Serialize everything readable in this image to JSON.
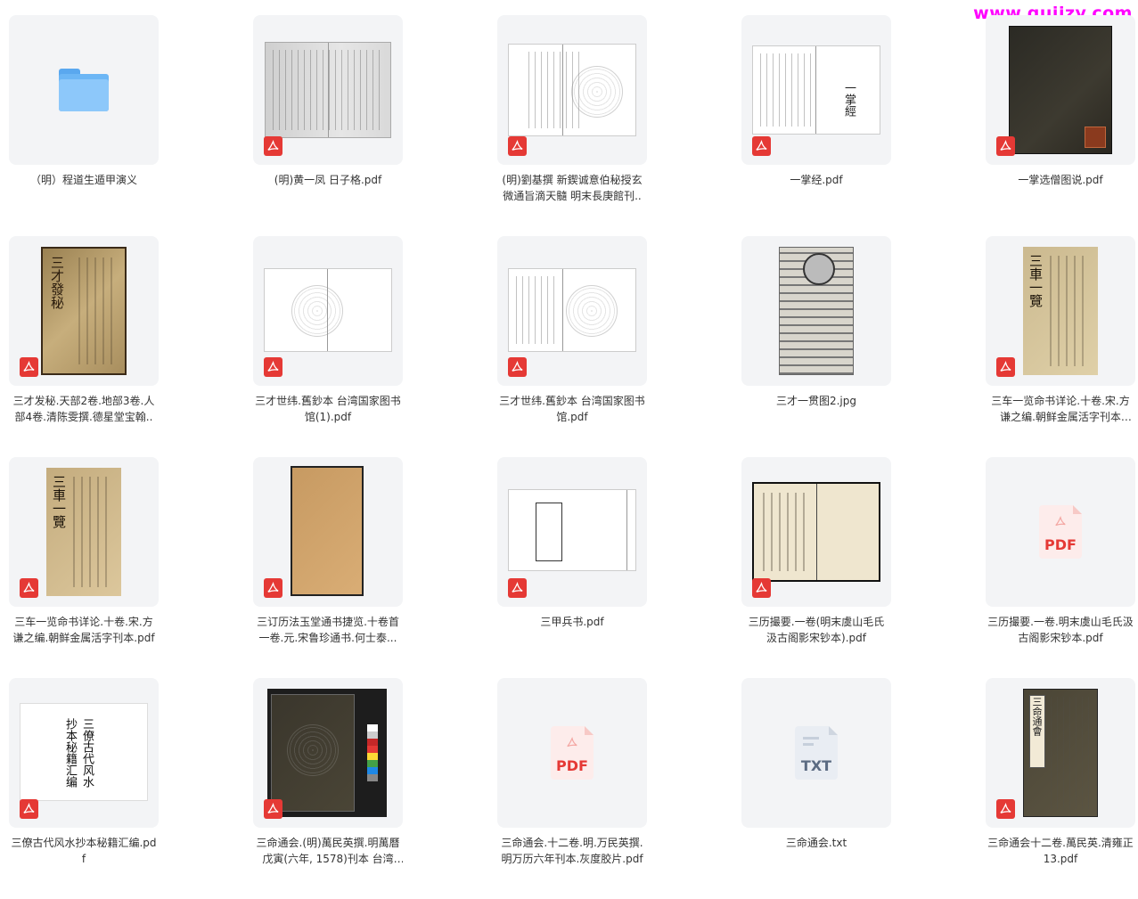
{
  "watermark": "www.gujizy.com",
  "colors": {
    "pdf_badge": "#e53935",
    "folder": "#6cb6f5",
    "watermark": "#ff00ff"
  },
  "files": [
    {
      "name": "（明）程道生遁甲演义",
      "type": "folder",
      "icon": "folder-icon"
    },
    {
      "name": "(明)黄一凤 日子格.pdf",
      "type": "pdf",
      "icon": "pdf-icon"
    },
    {
      "name": "(明)劉基撰 新鍥诚意伯秘授玄微通旨滴天髓 明末長庚館刊..",
      "type": "pdf",
      "icon": "pdf-icon"
    },
    {
      "name": "一掌经.pdf",
      "type": "pdf",
      "icon": "pdf-icon"
    },
    {
      "name": "一掌选僧图说.pdf",
      "type": "pdf",
      "icon": "pdf-icon"
    },
    {
      "name": "三才发秘.天部2卷.地部3卷.人部4卷.清陈雯撰.德星堂宝翰..",
      "type": "pdf",
      "icon": "pdf-icon"
    },
    {
      "name": "三才世纬.舊鈔本 台湾国家图书馆(1).pdf",
      "type": "pdf",
      "icon": "pdf-icon"
    },
    {
      "name": "三才世纬.舊鈔本 台湾国家图书馆.pdf",
      "type": "pdf",
      "icon": "pdf-icon"
    },
    {
      "name": "三才一贯图2.jpg",
      "type": "image",
      "icon": "image-icon"
    },
    {
      "name": "三车一览命书详论.十卷.宋.方谦之编.朝鲜金属活字刊本(1)....",
      "type": "pdf",
      "icon": "pdf-icon"
    },
    {
      "name": "三车一览命书详论.十卷.宋.方谦之编.朝鲜金属活字刊本.pdf",
      "type": "pdf",
      "icon": "pdf-icon"
    },
    {
      "name": "三订历法玉堂通书捷览.十卷首一卷.元.宋鲁珍通书.何士泰...",
      "type": "pdf",
      "icon": "pdf-icon"
    },
    {
      "name": "三甲兵书.pdf",
      "type": "pdf",
      "icon": "pdf-icon"
    },
    {
      "name": "三历撮要.一卷(明末虞山毛氏汲古阁影宋钞本).pdf",
      "type": "pdf",
      "icon": "pdf-icon"
    },
    {
      "name": "三历撮要.一卷.明末虞山毛氏汲古阁影宋钞本.pdf",
      "type": "pdf",
      "icon": "pdf-icon"
    },
    {
      "name": "三僚古代风水抄本秘籍汇编.pdf",
      "type": "pdf",
      "icon": "pdf-icon"
    },
    {
      "name": "三命通会.(明)萬民英撰.明萬曆戊寅(六年, 1578)刊本 台湾国..",
      "type": "pdf",
      "icon": "pdf-icon"
    },
    {
      "name": "三命通会.十二卷.明.万民英撰.明万历六年刊本.灰度胶片.pdf",
      "type": "pdf",
      "icon": "pdf-icon"
    },
    {
      "name": "三命通会.txt",
      "type": "txt",
      "icon": "txt-icon"
    },
    {
      "name": "三命通会十二卷.萬民英.清雍正13.pdf",
      "type": "pdf",
      "icon": "pdf-icon"
    }
  ],
  "icon_labels": {
    "pdf": "PDF",
    "txt": "TXT"
  },
  "thumb_texts": {
    "sancai_yiguan": "三才一貫圖",
    "sanliao": "三僚古代风水抄本秘籍汇编",
    "sanche": "三車一覽",
    "sancai_fami": "三才發秘",
    "yizhang": "一掌經",
    "sanming": "三命通會"
  }
}
